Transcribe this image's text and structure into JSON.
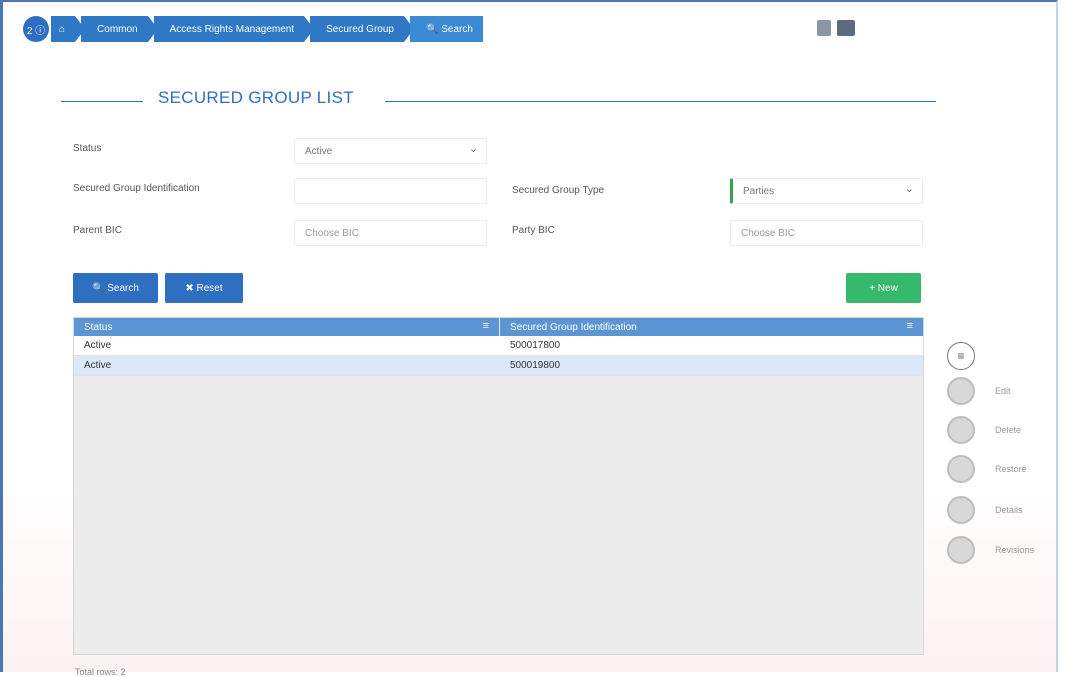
{
  "breadcrumb": {
    "info_badge": "2 ⓘ",
    "home_icon": "⌂",
    "items": [
      "Common",
      "Access Rights Management",
      "Secured Group"
    ],
    "search": "🔍 Search"
  },
  "page": {
    "title": "SECURED GROUP LIST"
  },
  "form": {
    "status_label": "Status",
    "status_value": "Active",
    "sg_id_label": "Secured Group Identification",
    "sg_id_value": "",
    "sg_type_label": "Secured Group Type",
    "sg_type_value": "Parties",
    "parent_bic_label": "Parent BIC",
    "parent_bic_placeholder": "Choose BIC",
    "party_bic_label": "Party BIC",
    "party_bic_placeholder": "Choose BIC"
  },
  "buttons": {
    "search": "🔍 Search",
    "reset": "✖ Reset",
    "new": "+ New"
  },
  "table": {
    "headers": [
      "Status",
      "Secured Group Identification"
    ],
    "header_menu_icon": "≡",
    "rows": [
      [
        "Active",
        "500017800"
      ],
      [
        "Active",
        "500019800"
      ]
    ]
  },
  "footer": {
    "total_rows": "Total rows: 2"
  },
  "actions": {
    "menu_icon": "≡",
    "items": [
      "Edit",
      "Delete",
      "Restore",
      "Details",
      "Revisions"
    ]
  },
  "colors": {
    "primary": "#2f6fc2",
    "new_button": "#35b86a",
    "header": "#5b95d4",
    "selected_row": "#dbe8f7"
  }
}
